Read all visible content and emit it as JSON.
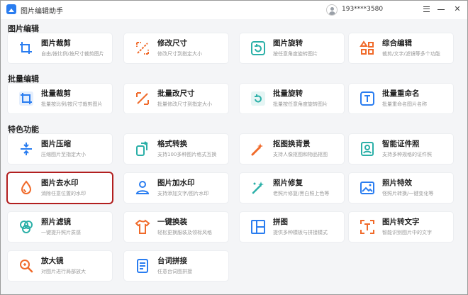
{
  "app": {
    "title": "图片编辑助手",
    "user_phone": "193****3580"
  },
  "colors": {
    "icon_blue": "#2a7df0",
    "icon_orange": "#f06a2a",
    "icon_teal": "#2bb0a8",
    "highlight": "#b21f1f"
  },
  "sections": [
    {
      "title": "图片编辑"
    },
    {
      "title": "批量编辑"
    },
    {
      "title": "特色功能"
    }
  ],
  "cards": [
    {
      "title": "图片裁剪",
      "desc": "自由/按比例/按尺寸裁剪图片",
      "icon": "crop-icon",
      "color": "blue"
    },
    {
      "title": "修改尺寸",
      "desc": "修改尺寸到指定大小",
      "icon": "resize-icon",
      "color": "orange"
    },
    {
      "title": "图片旋转",
      "desc": "按任意角度旋转图片",
      "icon": "rotate-icon",
      "color": "teal"
    },
    {
      "title": "综合编辑",
      "desc": "裁剪/文字/滤镜等多个功能",
      "icon": "grid-icon",
      "color": "orange"
    },
    {
      "title": "批量裁剪",
      "desc": "批量按比例/按尺寸裁剪图片",
      "icon": "batch-crop-icon",
      "color": "blue"
    },
    {
      "title": "批量改尺寸",
      "desc": "批量修改尺寸到指定大小",
      "icon": "batch-resize-icon",
      "color": "orange"
    },
    {
      "title": "批量旋转",
      "desc": "批量按任意角度旋转图片",
      "icon": "batch-rotate-icon",
      "color": "teal"
    },
    {
      "title": "批量重命名",
      "desc": "批量重命名图片名称",
      "icon": "rename-icon",
      "color": "blue"
    },
    {
      "title": "图片压缩",
      "desc": "压缩图片至指定大小",
      "icon": "compress-icon",
      "color": "blue"
    },
    {
      "title": "格式转换",
      "desc": "支持100多种图片格式互换",
      "icon": "convert-icon",
      "color": "teal"
    },
    {
      "title": "抠图换背景",
      "desc": "支持人像抠图和物品抠图",
      "icon": "cutout-icon",
      "color": "orange"
    },
    {
      "title": "智能证件照",
      "desc": "支持多种规格的证件照",
      "icon": "id-photo-icon",
      "color": "teal"
    },
    {
      "title": "图片去水印",
      "desc": "消除任意位置的水印",
      "icon": "remove-watermark-icon",
      "color": "orange"
    },
    {
      "title": "图片加水印",
      "desc": "支持添加文字/图片水印",
      "icon": "add-watermark-icon",
      "color": "blue"
    },
    {
      "title": "照片修复",
      "desc": "老照片修复/黑白照上色等",
      "icon": "restore-icon",
      "color": "teal"
    },
    {
      "title": "照片特效",
      "desc": "怪照片转换/一键变化等",
      "icon": "effects-icon",
      "color": "blue"
    },
    {
      "title": "照片滤镜",
      "desc": "一键提升照片质感",
      "icon": "filter-icon",
      "color": "teal"
    },
    {
      "title": "一键换装",
      "desc": "轻松更换服装及领标风格",
      "icon": "outfit-icon",
      "color": "orange"
    },
    {
      "title": "拼图",
      "desc": "提供多种模板与拼接模式",
      "icon": "collage-icon",
      "color": "blue"
    },
    {
      "title": "图片转文字",
      "desc": "智能识别图片中的文字",
      "icon": "ocr-icon",
      "color": "orange"
    },
    {
      "title": "放大镜",
      "desc": "对图片进行局部放大",
      "icon": "magnifier-icon",
      "color": "orange"
    },
    {
      "title": "台词拼接",
      "desc": "任意台词图拼接",
      "icon": "subtitle-stitch-icon",
      "color": "blue"
    }
  ]
}
